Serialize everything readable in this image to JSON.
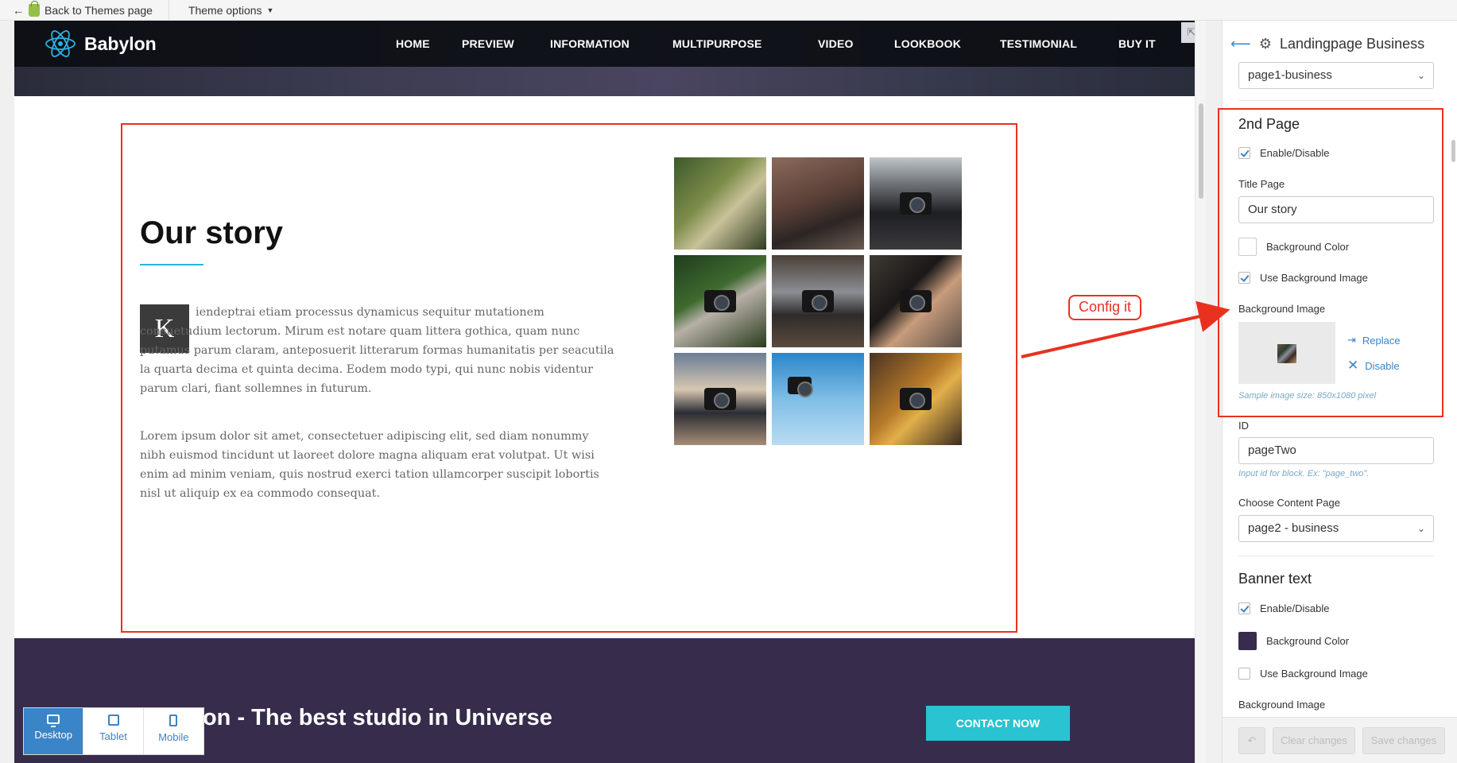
{
  "topbar": {
    "back_label": "Back to Themes page",
    "options_label": "Theme options"
  },
  "site": {
    "logo": "Babylon",
    "nav": [
      "HOME",
      "PREVIEW",
      "INFORMATION",
      "MULTIPURPOSE",
      "VIDEO",
      "LOOKBOOK",
      "TESTIMONIAL",
      "BUY IT"
    ],
    "story": {
      "title": "Our story",
      "dropcap": "K",
      "para1": "iendeptrai etiam processus dynamicus sequitur mutationem consuetudium lectorum. Mirum est notare quam littera gothica, quam nunc putamus parum claram, anteposuerit litterarum formas humanitatis per seacutila la quarta decima et quinta decima. Eodem modo typi, qui nunc nobis videntur parum clari, fiant sollemnes in futurum.",
      "para2": "Lorem ipsum dolor sit amet, consectetuer adipiscing elit, sed diam nonummy nibh euismod tincidunt ut laoreet dolore magna aliquam erat volutpat. Ut wisi enim ad minim veniam, quis nostrud exerci tation ullamcorper suscipit lobortis nisl ut aliquip ex ea commodo consequat."
    },
    "banner": {
      "title": "Babylon - The best studio in Universe",
      "button": "CONTACT NOW"
    }
  },
  "annotation": {
    "callout": "Config it"
  },
  "devices": [
    "Desktop",
    "Tablet",
    "Mobile"
  ],
  "sidebar": {
    "title": "Landingpage Business",
    "prev_select": "page1-business",
    "section_2nd": {
      "heading": "2nd Page",
      "enable_label": "Enable/Disable",
      "title_page_label": "Title Page",
      "title_page_value": "Our story",
      "bg_color_label": "Background Color",
      "use_bg_image_label": "Use Background Image",
      "bg_image_label": "Background Image",
      "replace_label": "Replace",
      "disable_label": "Disable",
      "sample_hint": "Sample image size: 850x1080 pixel",
      "id_label": "ID",
      "id_value": "pageTwo",
      "id_hint": "Input id for block. Ex: \"page_two\".",
      "content_label": "Choose Content Page",
      "content_value": "page2 - business"
    },
    "section_banner": {
      "heading": "Banner text",
      "enable_label": "Enable/Disable",
      "bg_color_label": "Background Color",
      "bg_color": "#382c4c",
      "use_bg_image_label": "Use Background Image",
      "bg_image_label": "Background Image"
    },
    "footer": {
      "clear_label": "Clear changes",
      "save_label": "Save changes"
    }
  },
  "colors": {
    "accent": "#3a84c8",
    "highlight": "#e8321f",
    "banner": "#382c4c",
    "cta": "#29c3d2"
  }
}
